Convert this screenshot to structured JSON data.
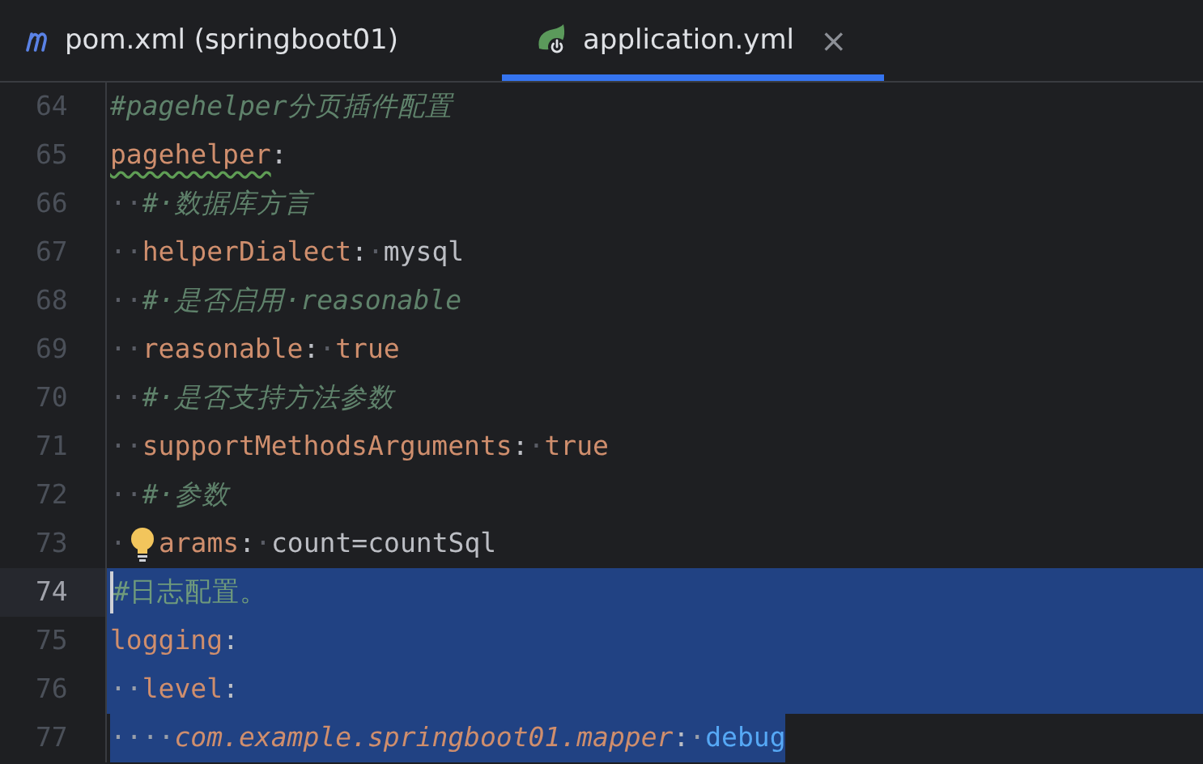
{
  "tabs": [
    {
      "kind": "maven",
      "label": "pom.xml (springboot01)",
      "selected": false
    },
    {
      "kind": "spring",
      "label": "application.yml",
      "selected": true,
      "close": "×"
    }
  ],
  "editor": {
    "lines": [
      {
        "number": "64",
        "current": false,
        "selected": false,
        "tokens": [
          {
            "kind": "comment",
            "text": "#pagehelper分页插件配置"
          }
        ]
      },
      {
        "number": "65",
        "current": false,
        "selected": false,
        "tokens": [
          {
            "kind": "key",
            "text": "pagehelper",
            "typo": true
          },
          {
            "kind": "punct",
            "text": ":"
          }
        ]
      },
      {
        "number": "66",
        "current": false,
        "selected": false,
        "tokens": [
          {
            "kind": "space",
            "text": "··"
          },
          {
            "kind": "comment",
            "text": "#·数据库方言"
          }
        ]
      },
      {
        "number": "67",
        "current": false,
        "selected": false,
        "tokens": [
          {
            "kind": "space",
            "text": "··"
          },
          {
            "kind": "key",
            "text": "helperDialect"
          },
          {
            "kind": "punct",
            "text": ":"
          },
          {
            "kind": "space",
            "text": "·"
          },
          {
            "kind": "plain",
            "text": "mysql"
          }
        ]
      },
      {
        "number": "68",
        "current": false,
        "selected": false,
        "tokens": [
          {
            "kind": "space",
            "text": "··"
          },
          {
            "kind": "comment",
            "text": "#·是否启用·reasonable"
          }
        ]
      },
      {
        "number": "69",
        "current": false,
        "selected": false,
        "tokens": [
          {
            "kind": "space",
            "text": "··"
          },
          {
            "kind": "key",
            "text": "reasonable"
          },
          {
            "kind": "punct",
            "text": ":"
          },
          {
            "kind": "space",
            "text": "·"
          },
          {
            "kind": "bool",
            "text": "true"
          }
        ]
      },
      {
        "number": "70",
        "current": false,
        "selected": false,
        "tokens": [
          {
            "kind": "space",
            "text": "··"
          },
          {
            "kind": "comment",
            "text": "#·是否支持方法参数"
          }
        ]
      },
      {
        "number": "71",
        "current": false,
        "selected": false,
        "tokens": [
          {
            "kind": "space",
            "text": "··"
          },
          {
            "kind": "key",
            "text": "supportMethodsArguments"
          },
          {
            "kind": "punct",
            "text": ":"
          },
          {
            "kind": "space",
            "text": "·"
          },
          {
            "kind": "bool",
            "text": "true"
          }
        ]
      },
      {
        "number": "72",
        "current": false,
        "selected": false,
        "tokens": [
          {
            "kind": "space",
            "text": "··"
          },
          {
            "kind": "comment",
            "text": "#·参数"
          }
        ]
      },
      {
        "number": "73",
        "current": false,
        "selected": false,
        "tokens": [
          {
            "kind": "space",
            "text": "·"
          },
          {
            "kind": "bulb"
          },
          {
            "kind": "key",
            "text": "arams"
          },
          {
            "kind": "punct",
            "text": ":"
          },
          {
            "kind": "space",
            "text": "·"
          },
          {
            "kind": "plain",
            "text": "count=countSql"
          }
        ]
      },
      {
        "number": "74",
        "current": true,
        "selected": true,
        "tokens": [
          {
            "kind": "comment-plain",
            "text": "#日志配置。"
          }
        ]
      },
      {
        "number": "75",
        "current": false,
        "selected": true,
        "tokens": [
          {
            "kind": "key",
            "text": "logging"
          },
          {
            "kind": "punct",
            "text": ":"
          }
        ]
      },
      {
        "number": "76",
        "current": false,
        "selected": true,
        "tokens": [
          {
            "kind": "space",
            "text": "··"
          },
          {
            "kind": "key",
            "text": "level"
          },
          {
            "kind": "punct",
            "text": ":"
          }
        ]
      },
      {
        "number": "77",
        "current": false,
        "selected": true,
        "selection_ends_at_text": true,
        "tokens": [
          {
            "kind": "space",
            "text": "····"
          },
          {
            "kind": "key-italic",
            "text": "com.example.springboot01.mapper"
          },
          {
            "kind": "punct",
            "text": ":"
          },
          {
            "kind": "space",
            "text": "·"
          },
          {
            "kind": "level",
            "text": "debug"
          }
        ]
      }
    ]
  }
}
